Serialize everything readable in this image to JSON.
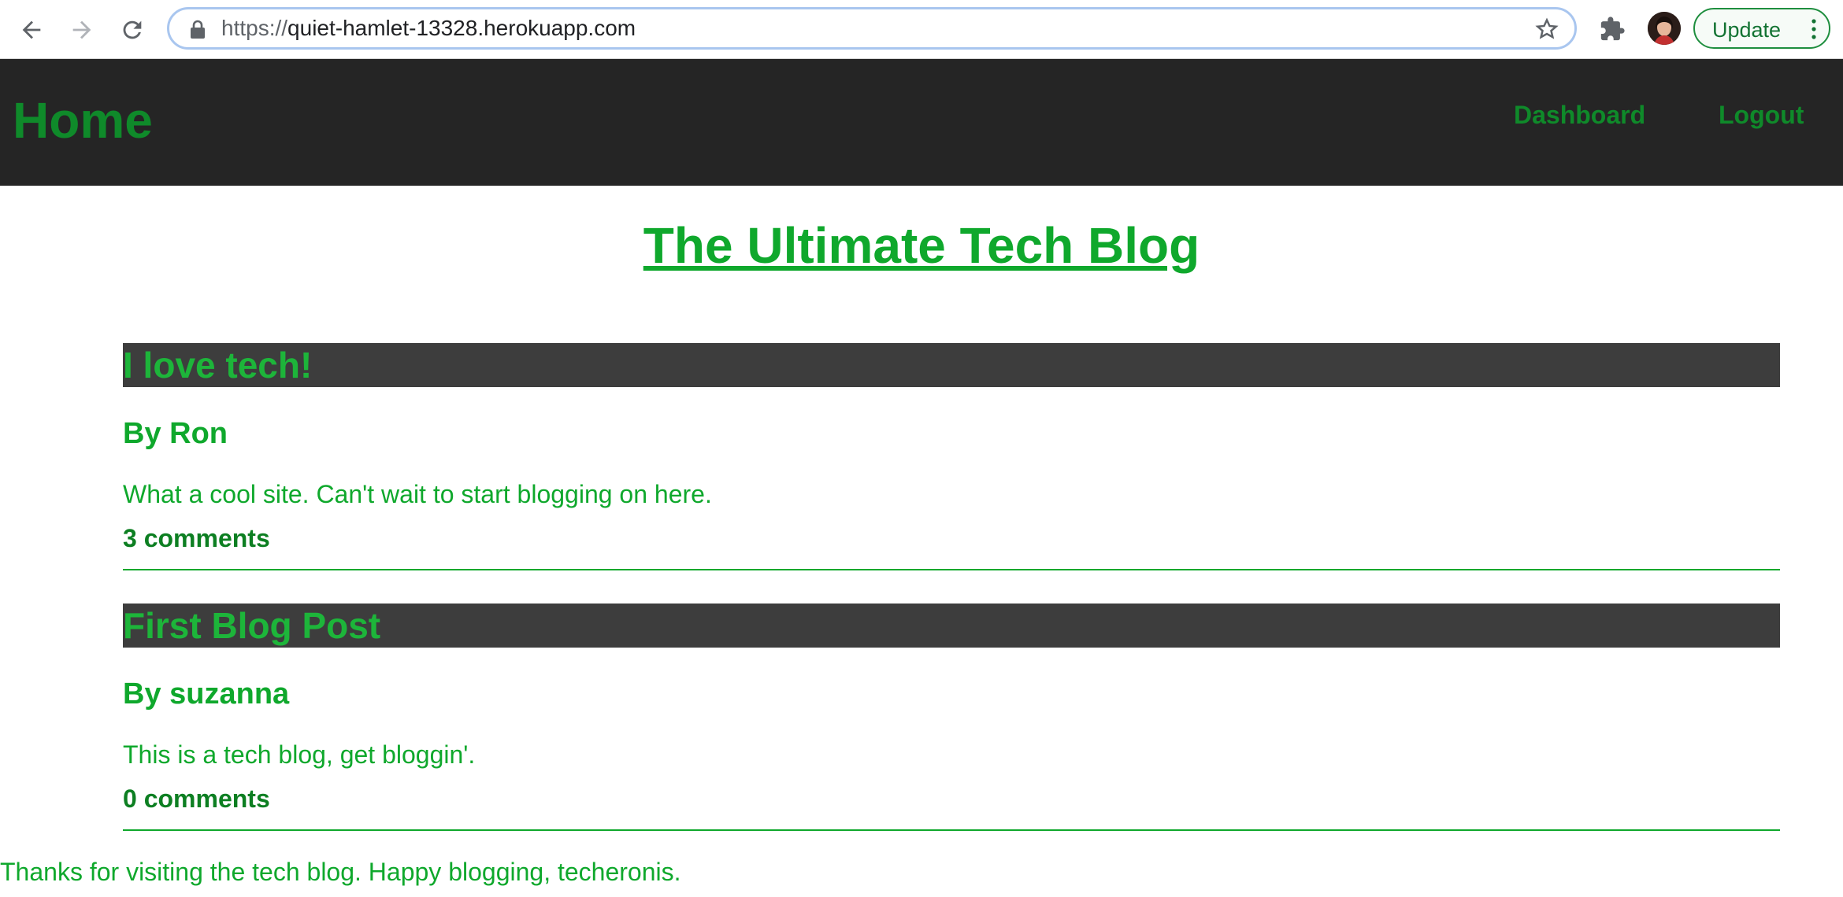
{
  "browser": {
    "url_scheme": "https://",
    "url_host": "quiet-hamlet-13328.herokuapp.com",
    "update_label": "Update",
    "icons": [
      "back-arrow-icon",
      "forward-arrow-icon",
      "reload-icon",
      "lock-icon",
      "star-icon",
      "extensions-icon",
      "menu-dots-icon"
    ]
  },
  "header": {
    "home_label": "Home",
    "nav": [
      {
        "label": "Dashboard"
      },
      {
        "label": "Logout"
      }
    ]
  },
  "main": {
    "title": "The Ultimate Tech Blog",
    "posts": [
      {
        "title": "I love tech!",
        "author": "By Ron",
        "body": "What a cool site. Can't wait to start blogging on here.",
        "comments": "3 comments"
      },
      {
        "title": "First Blog Post",
        "author": "By suzanna",
        "body": "This is a tech blog, get bloggin'.",
        "comments": "0 comments"
      }
    ]
  },
  "footer": {
    "text": "Thanks for visiting the tech blog. Happy blogging, techeronis."
  },
  "colors": {
    "header_bg": "#252525",
    "accent_green": "#0fa82c",
    "post_title_bg": "#3d3d3d"
  }
}
